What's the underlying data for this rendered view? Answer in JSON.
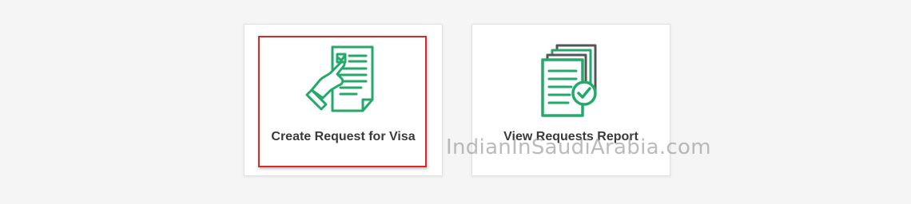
{
  "cards": [
    {
      "label": "Create Request for Visa",
      "icon": "hand-document-icon",
      "highlighted": true
    },
    {
      "label": "View Requests Report",
      "icon": "documents-check-icon",
      "highlighted": false
    }
  ],
  "watermark": "IndianInSaudiArabia.com",
  "colors": {
    "icon_green": "#22aa6a",
    "highlight_red": "#d42a2a",
    "page_background": "#f5f5f5",
    "label_text": "#3a3a3a"
  }
}
